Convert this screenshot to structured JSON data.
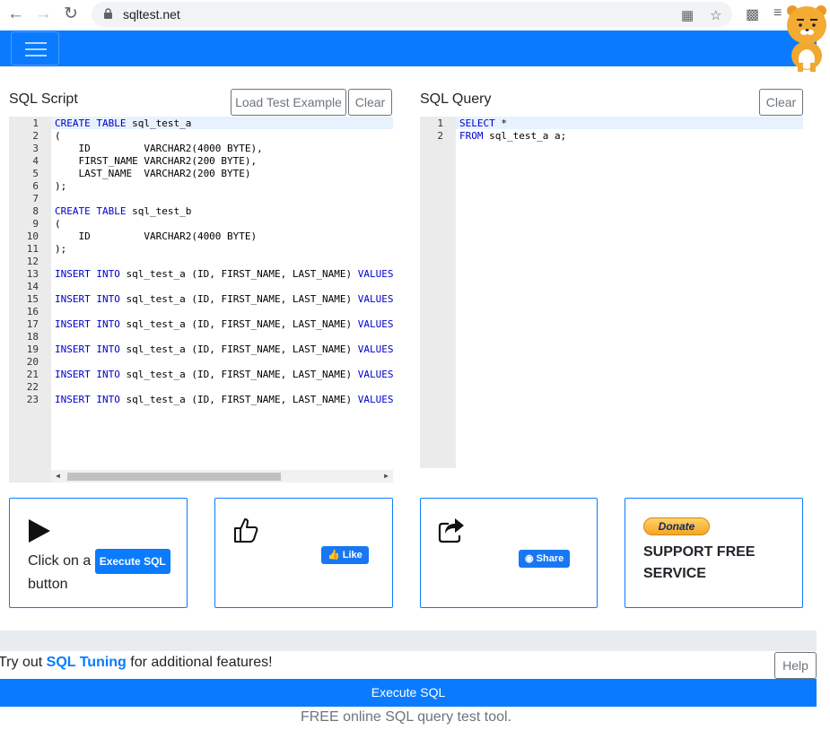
{
  "browser": {
    "url": "sqltest.net",
    "icons": {
      "back": "back-arrow-icon",
      "forward": "forward-arrow-icon",
      "reload": "reload-icon",
      "translate": "translate-icon",
      "bookmark": "star-icon",
      "extensions": "puzzle-icon",
      "media": "media-queue-icon"
    }
  },
  "script_panel": {
    "title": "SQL Script",
    "load_example_label": "Load Test Example",
    "clear_label": "Clear",
    "lines": [
      {
        "n": "1",
        "kw": "CREATE TABLE",
        "rest": " sql_test_a"
      },
      {
        "n": "2",
        "kw": "",
        "rest": "("
      },
      {
        "n": "3",
        "kw": "",
        "rest": "    ID         VARCHAR2(4000 BYTE),"
      },
      {
        "n": "4",
        "kw": "",
        "rest": "    FIRST_NAME VARCHAR2(200 BYTE),"
      },
      {
        "n": "5",
        "kw": "",
        "rest": "    LAST_NAME  VARCHAR2(200 BYTE)"
      },
      {
        "n": "6",
        "kw": "",
        "rest": ");"
      },
      {
        "n": "7",
        "kw": "",
        "rest": ""
      },
      {
        "n": "8",
        "kw": "CREATE TABLE",
        "rest": " sql_test_b"
      },
      {
        "n": "9",
        "kw": "",
        "rest": "("
      },
      {
        "n": "10",
        "kw": "",
        "rest": "    ID         VARCHAR2(4000 BYTE)"
      },
      {
        "n": "11",
        "kw": "",
        "rest": ");"
      },
      {
        "n": "12",
        "kw": "",
        "rest": ""
      },
      {
        "n": "13",
        "kw": "INSERT INTO",
        "rest": " sql_test_a (ID, FIRST_NAME, LAST_NAME) ",
        "kw2": "VALUES"
      },
      {
        "n": "14",
        "kw": "",
        "rest": ""
      },
      {
        "n": "15",
        "kw": "INSERT INTO",
        "rest": " sql_test_a (ID, FIRST_NAME, LAST_NAME) ",
        "kw2": "VALUES"
      },
      {
        "n": "16",
        "kw": "",
        "rest": ""
      },
      {
        "n": "17",
        "kw": "INSERT INTO",
        "rest": " sql_test_a (ID, FIRST_NAME, LAST_NAME) ",
        "kw2": "VALUES"
      },
      {
        "n": "18",
        "kw": "",
        "rest": ""
      },
      {
        "n": "19",
        "kw": "INSERT INTO",
        "rest": " sql_test_a (ID, FIRST_NAME, LAST_NAME) ",
        "kw2": "VALUES"
      },
      {
        "n": "20",
        "kw": "",
        "rest": ""
      },
      {
        "n": "21",
        "kw": "INSERT INTO",
        "rest": " sql_test_a (ID, FIRST_NAME, LAST_NAME) ",
        "kw2": "VALUES"
      },
      {
        "n": "22",
        "kw": "",
        "rest": ""
      },
      {
        "n": "23",
        "kw": "INSERT INTO",
        "rest": " sql_test_a (ID, FIRST_NAME, LAST_NAME) ",
        "kw2": "VALUES"
      }
    ]
  },
  "query_panel": {
    "title": "SQL Query",
    "clear_label": "Clear",
    "lines": [
      {
        "n": "1",
        "kw": "SELECT",
        "rest": " *"
      },
      {
        "n": "2",
        "kw": "FROM",
        "rest": " sql_test_a a;"
      }
    ]
  },
  "cards": {
    "execute": {
      "text_before": "Click on a",
      "button_label": "Execute SQL",
      "text_after": "button"
    },
    "like": {
      "label": "Like"
    },
    "share": {
      "label": "Share"
    },
    "support": {
      "donate_label": "Donate",
      "text_line1": "SUPPORT FREE",
      "text_line2": "SERVICE"
    }
  },
  "promo": {
    "prefix": "Try out",
    "link": "SQL Tuning",
    "suffix": "for additional features!",
    "help_label": "Help"
  },
  "execute_bar": {
    "label": "Execute SQL"
  },
  "footer": {
    "text": "FREE online SQL query test tool."
  },
  "colors": {
    "primary": "#0a7bff",
    "keyword": "#0000cc",
    "facebook": "#1877f2"
  }
}
